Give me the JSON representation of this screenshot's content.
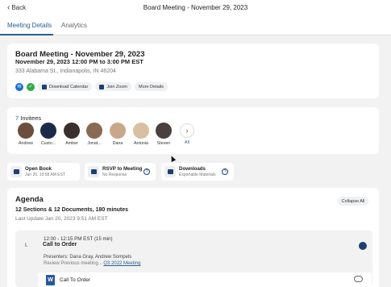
{
  "header": {
    "back_label": "Back",
    "title": "Board Meeting - November 29, 2023"
  },
  "tabs": [
    {
      "label": "Meeting Details"
    },
    {
      "label": "Analytics"
    }
  ],
  "meeting": {
    "title": "Board Meeting - November 29, 2023",
    "datetime": "November 29, 2023 12:00 PM to 3:00 PM EST",
    "address": "333 Alabama St., Indianapolis, IN 46204",
    "actions": {
      "download_calendar": "Download Calendar",
      "join_zoom": "Join Zoom",
      "more_details": "More Details"
    }
  },
  "invitees": {
    "count": "7",
    "label": "Invitees",
    "people": [
      {
        "name": "Andrew",
        "color": "#6b4e3d"
      },
      {
        "name": "Custo...",
        "color": "#1c2a4a"
      },
      {
        "name": "Amber",
        "color": "#3a2f2a"
      },
      {
        "name": "Jonat...",
        "color": "#8a6a52"
      },
      {
        "name": "Dana",
        "color": "#c9a88a"
      },
      {
        "name": "Antonia",
        "color": "#d8c0a0"
      },
      {
        "name": "Steven",
        "color": "#4a4040"
      }
    ],
    "all_label": "All"
  },
  "quick_cards": [
    {
      "title": "Open Book",
      "subtitle": "Jan 20, 10:58 AM EST"
    },
    {
      "title": "RSVP to Meeting",
      "subtitle": "No Response"
    },
    {
      "title": "Downloads",
      "subtitle": "Exportable Materials"
    }
  ],
  "agenda": {
    "title": "Agenda",
    "collapse_label": "Collapse All",
    "summary": "12 Sections & 12 Documents, 180 minutes",
    "updated": "Last Update Jan 20, 2023 9:51 AM EST",
    "item": {
      "time": "12:00 - 12:15 PM EST (15 min)",
      "number": "I.",
      "name": "Call to Order",
      "presenters": "Presenters: Dana Gray, Andrew Sompels",
      "review_prefix": "Review Previous meeting...",
      "review_link": "Q3 2022 Meeting",
      "document": "Call To Order"
    }
  },
  "colors": {
    "accent": "#2a5f8f",
    "navy": "#1f3f6e",
    "email": "#1f6fd1",
    "check": "#2eaa4a"
  }
}
